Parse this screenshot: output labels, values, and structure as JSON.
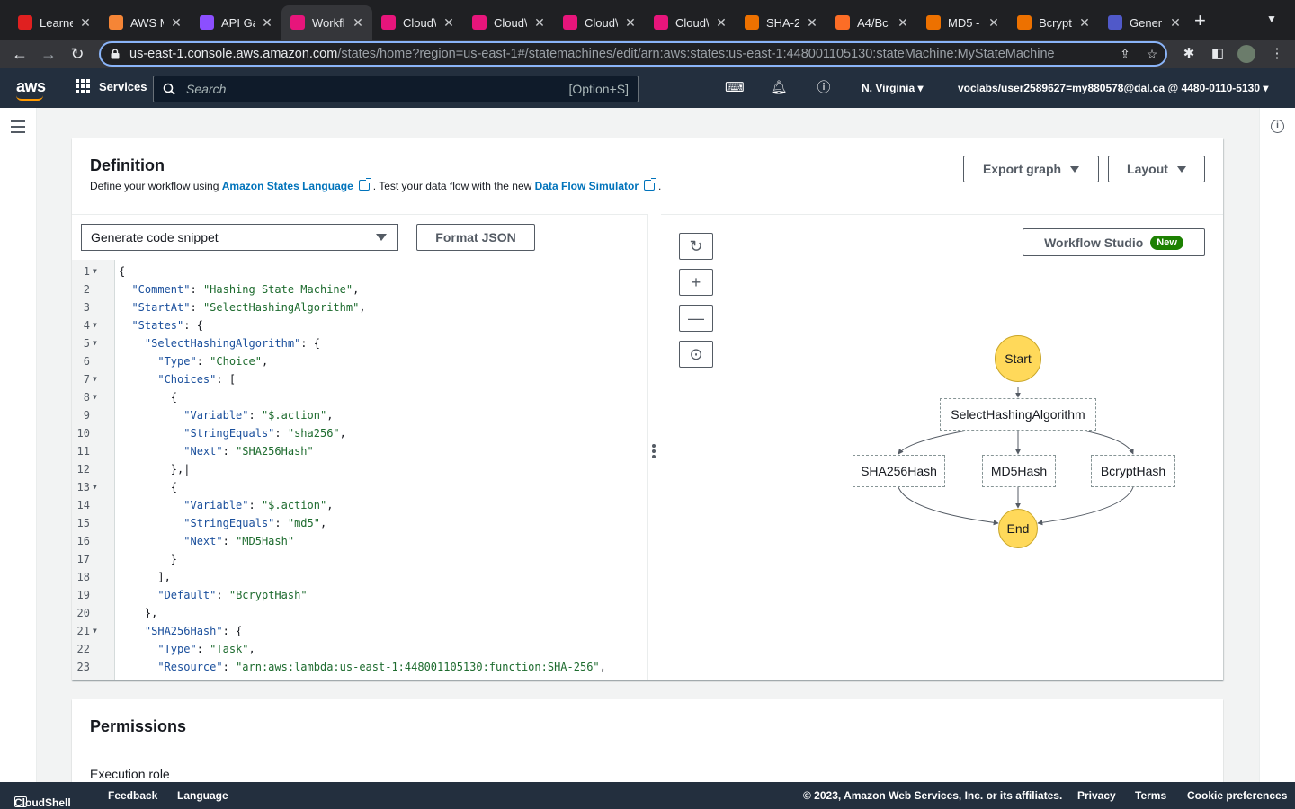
{
  "browser": {
    "tabs": [
      {
        "title": "Learner",
        "favicon_color": "#e02020"
      },
      {
        "title": "AWS M",
        "favicon_color": "#f58536"
      },
      {
        "title": "API Ga",
        "favicon_color": "#8c4fff"
      },
      {
        "title": "Workfl",
        "favicon_color": "#e7157b"
      },
      {
        "title": "Cloud\\",
        "favicon_color": "#e7157b"
      },
      {
        "title": "Cloud\\",
        "favicon_color": "#e7157b"
      },
      {
        "title": "Cloud\\",
        "favicon_color": "#e7157b"
      },
      {
        "title": "Cloud\\",
        "favicon_color": "#e7157b"
      },
      {
        "title": "SHA-2",
        "favicon_color": "#ed7100"
      },
      {
        "title": "A4/Bc",
        "favicon_color": "#fc6d26"
      },
      {
        "title": "MD5 -",
        "favicon_color": "#ed7100"
      },
      {
        "title": "Bcrypt",
        "favicon_color": "#ed7100"
      },
      {
        "title": "Gener",
        "favicon_color": "#5059c9"
      }
    ],
    "url_host": "us-east-1.console.aws.amazon.com",
    "url_path": "/states/home?region=us-east-1#/statemachines/edit/arn:aws:states:us-east-1:448001105130:stateMachine:MyStateMachine"
  },
  "aws_nav": {
    "logo": "aws",
    "services_label": "Services",
    "search_placeholder": "Search",
    "search_shortcut": "[Option+S]",
    "region": "N. Virginia",
    "account": "voclabs/user2589627=my880578@dal.ca @ 4480-0110-5130"
  },
  "definition": {
    "title": "Definition",
    "desc_prefix": "Define your workflow using ",
    "asl_link": "Amazon States Language",
    "desc_middle": ". Test your data flow with the new ",
    "simulator_link": "Data Flow Simulator",
    "desc_suffix": ".",
    "export_graph": "Export graph",
    "layout": "Layout",
    "snippet_select": "Generate code snippet",
    "format_json": "Format JSON",
    "workflow_studio": "Workflow Studio",
    "new_badge": "New"
  },
  "code_lines": [
    {
      "n": "1",
      "fold": true,
      "text": "{"
    },
    {
      "n": "2",
      "fold": false,
      "text": "  \"Comment\": \"Hashing State Machine\","
    },
    {
      "n": "3",
      "fold": false,
      "text": "  \"StartAt\": \"SelectHashingAlgorithm\","
    },
    {
      "n": "4",
      "fold": true,
      "text": "  \"States\": {"
    },
    {
      "n": "5",
      "fold": true,
      "text": "    \"SelectHashingAlgorithm\": {"
    },
    {
      "n": "6",
      "fold": false,
      "text": "      \"Type\": \"Choice\","
    },
    {
      "n": "7",
      "fold": true,
      "text": "      \"Choices\": ["
    },
    {
      "n": "8",
      "fold": true,
      "text": "        {"
    },
    {
      "n": "9",
      "fold": false,
      "text": "          \"Variable\": \"$.action\","
    },
    {
      "n": "10",
      "fold": false,
      "text": "          \"StringEquals\": \"sha256\","
    },
    {
      "n": "11",
      "fold": false,
      "text": "          \"Next\": \"SHA256Hash\""
    },
    {
      "n": "12",
      "fold": false,
      "text": "        },|"
    },
    {
      "n": "13",
      "fold": true,
      "text": "        {"
    },
    {
      "n": "14",
      "fold": false,
      "text": "          \"Variable\": \"$.action\","
    },
    {
      "n": "15",
      "fold": false,
      "text": "          \"StringEquals\": \"md5\","
    },
    {
      "n": "16",
      "fold": false,
      "text": "          \"Next\": \"MD5Hash\""
    },
    {
      "n": "17",
      "fold": false,
      "text": "        }"
    },
    {
      "n": "18",
      "fold": false,
      "text": "      ],"
    },
    {
      "n": "19",
      "fold": false,
      "text": "      \"Default\": \"BcryptHash\""
    },
    {
      "n": "20",
      "fold": false,
      "text": "    },"
    },
    {
      "n": "21",
      "fold": true,
      "text": "    \"SHA256Hash\": {"
    },
    {
      "n": "22",
      "fold": false,
      "text": "      \"Type\": \"Task\","
    },
    {
      "n": "23",
      "fold": false,
      "text": "      \"Resource\": \"arn:aws:lambda:us-east-1:448001105130:function:SHA-256\","
    }
  ],
  "graph": {
    "start": "Start",
    "choice": "SelectHashingAlgorithm",
    "tasks": [
      "SHA256Hash",
      "MD5Hash",
      "BcryptHash"
    ],
    "end": "End",
    "terminal_color": "#ffd95a"
  },
  "permissions": {
    "title": "Permissions",
    "execution_role": "Execution role"
  },
  "footer": {
    "cloudshell": "CloudShell",
    "feedback": "Feedback",
    "language": "Language",
    "copyright": "© 2023, Amazon Web Services, Inc. or its affiliates.",
    "privacy": "Privacy",
    "terms": "Terms",
    "cookies": "Cookie preferences"
  }
}
